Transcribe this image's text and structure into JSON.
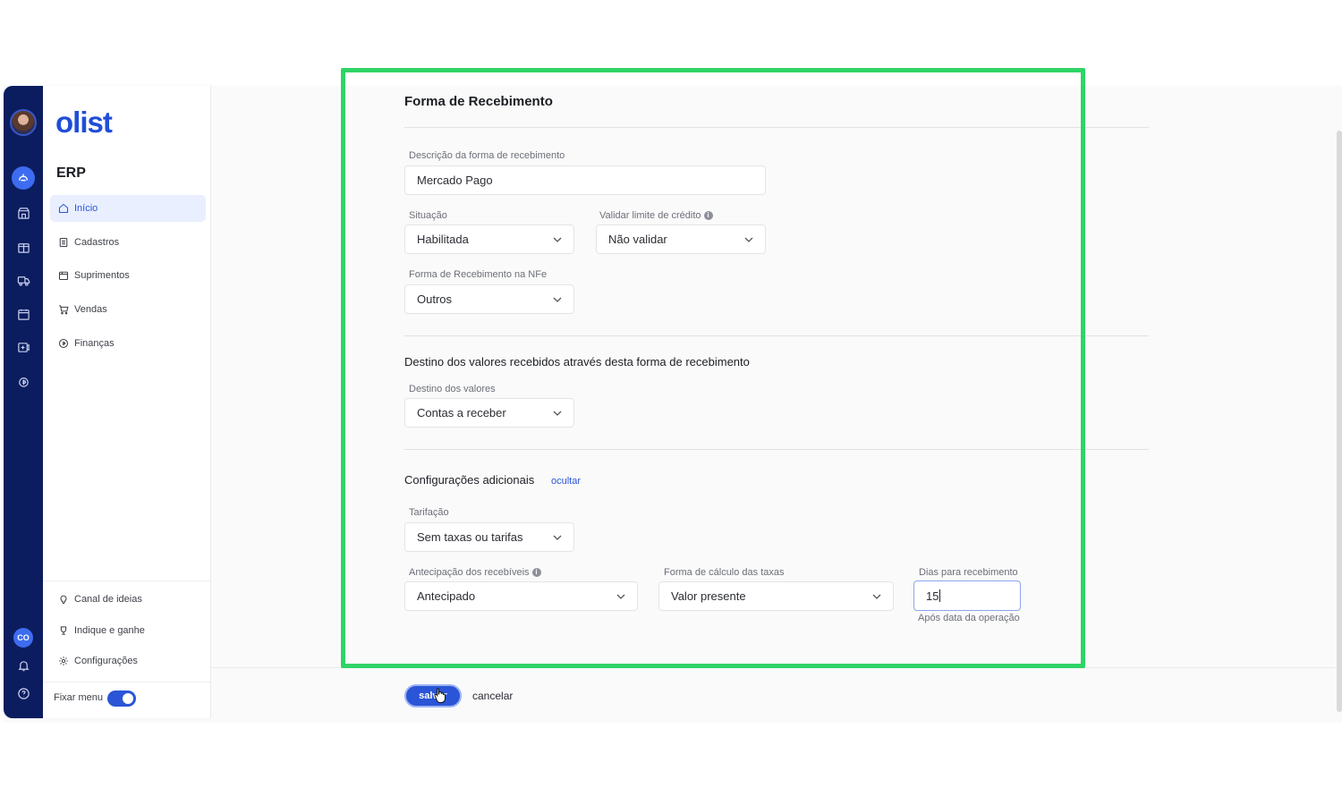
{
  "sidebar": {
    "logo": "olist",
    "section_title": "ERP",
    "nav": [
      {
        "label": "Início",
        "icon": "home-icon",
        "active": true
      },
      {
        "label": "Cadastros",
        "icon": "list-icon"
      },
      {
        "label": "Suprimentos",
        "icon": "box-icon"
      },
      {
        "label": "Vendas",
        "icon": "cart-icon"
      },
      {
        "label": "Finanças",
        "icon": "coin-icon"
      }
    ],
    "bottom": [
      {
        "label": "Canal de ideias",
        "icon": "lightbulb-icon"
      },
      {
        "label": "Indique e ganhe",
        "icon": "trophy-icon"
      },
      {
        "label": "Configurações",
        "icon": "gear-icon"
      }
    ],
    "pin_label": "Fixar menu",
    "pin_enabled": true
  },
  "rail": {
    "badge": "CO"
  },
  "form": {
    "title": "Forma de Recebimento",
    "descricao": {
      "label": "Descrição da forma de recebimento",
      "value": "Mercado Pago"
    },
    "situacao": {
      "label": "Situação",
      "value": "Habilitada"
    },
    "validar": {
      "label": "Validar limite de crédito",
      "value": "Não validar"
    },
    "nfe": {
      "label": "Forma de Recebimento na NFe",
      "value": "Outros"
    },
    "destino_title": "Destino dos valores recebidos através desta forma de recebimento",
    "destino": {
      "label": "Destino dos valores",
      "value": "Contas a receber"
    },
    "config_title": "Configurações adicionais",
    "config_toggle": "ocultar",
    "tarifacao": {
      "label": "Tarifação",
      "value": "Sem taxas ou tarifas"
    },
    "antecipacao": {
      "label": "Antecipação dos recebíveis",
      "value": "Antecipado"
    },
    "calculo": {
      "label": "Forma de cálculo das taxas",
      "value": "Valor presente"
    },
    "dias": {
      "label": "Dias para recebimento",
      "value": "15",
      "hint": "Após data da operação"
    }
  },
  "actions": {
    "save": "salvar",
    "cancel": "cancelar"
  },
  "colors": {
    "accent": "#2b55d6",
    "rail": "#0b1d5e",
    "highlight": "#2fd465"
  }
}
